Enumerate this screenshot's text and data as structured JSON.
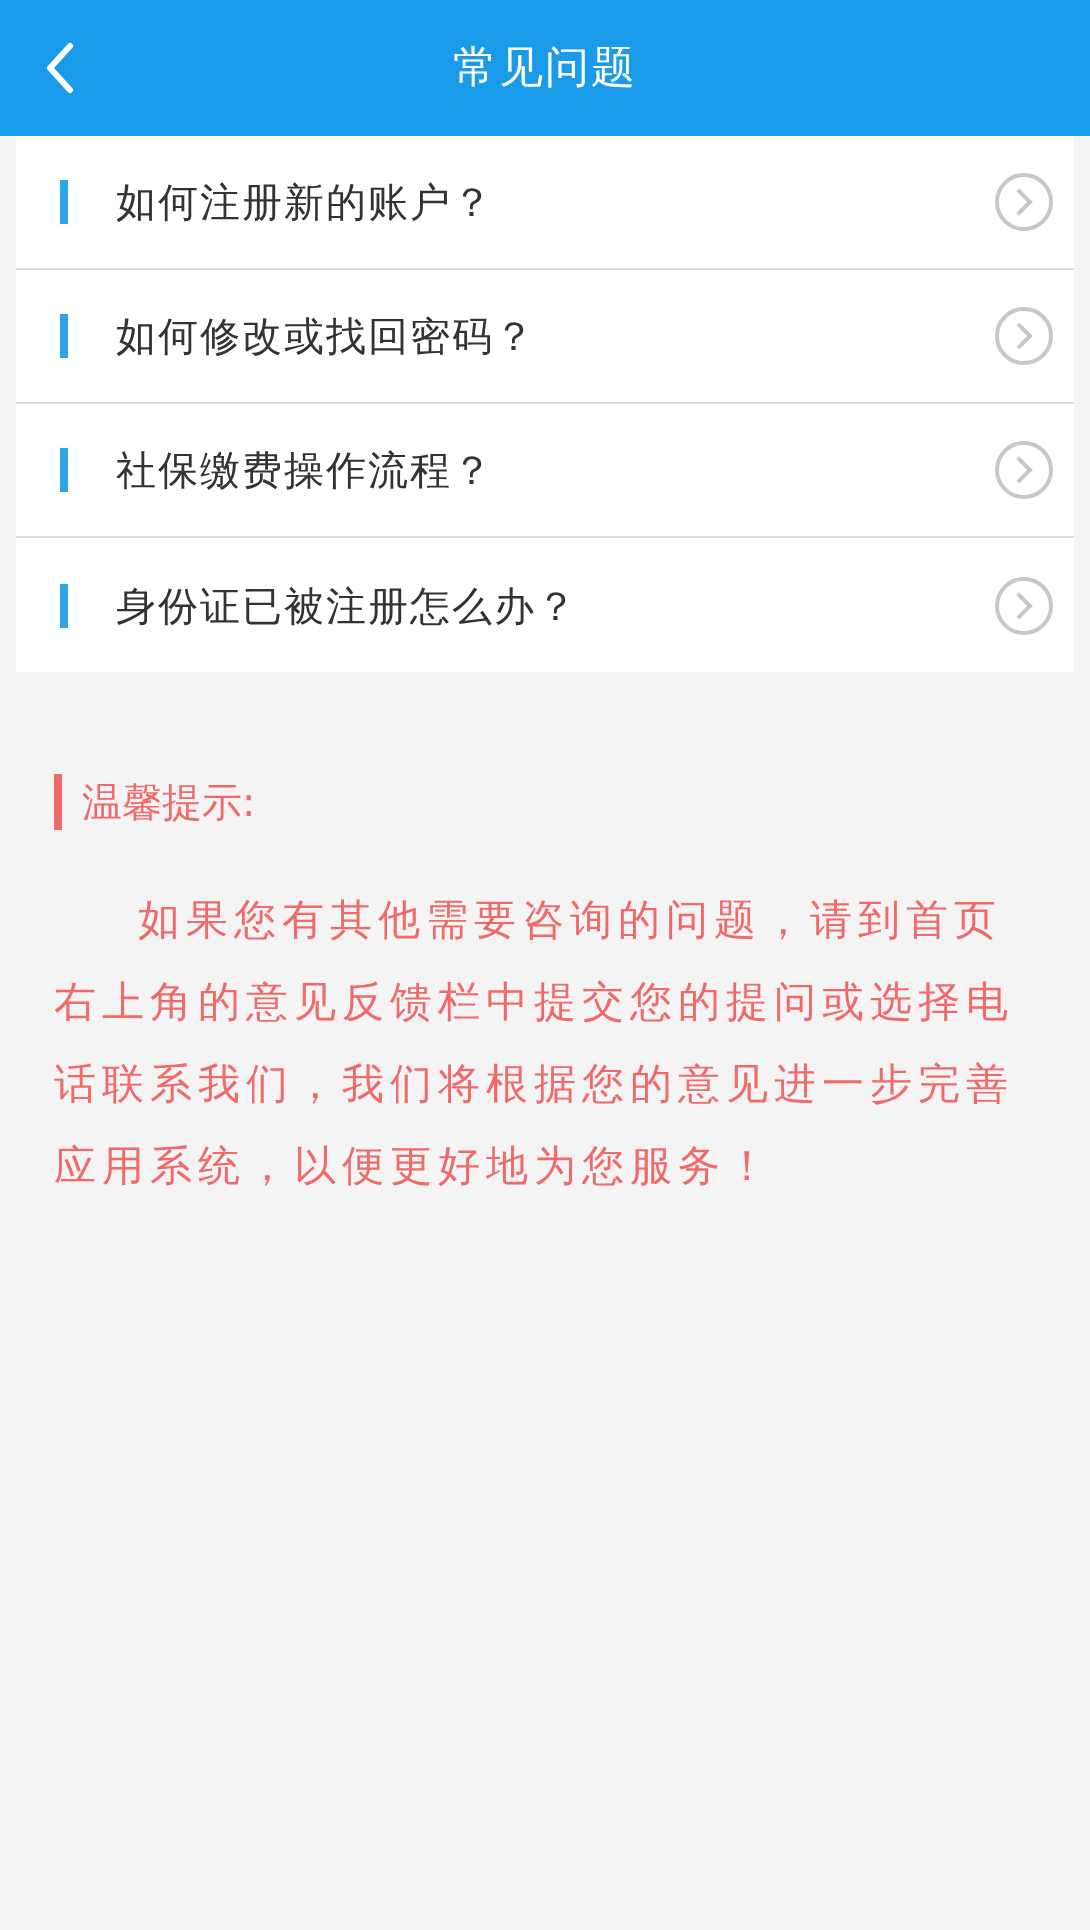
{
  "header": {
    "title": "常见问题"
  },
  "questions": [
    {
      "text": "如何注册新的账户？"
    },
    {
      "text": "如何修改或找回密码？"
    },
    {
      "text": "社保缴费操作流程？"
    },
    {
      "text": "身份证已被注册怎么办？"
    }
  ],
  "tip": {
    "title": "温馨提示:",
    "body": "如果您有其他需要咨询的问题，请到首页右上角的意见反馈栏中提交您的提问或选择电话联系我们，我们将根据您的意见进一步完善应用系统，以便更好地为您服务！"
  }
}
